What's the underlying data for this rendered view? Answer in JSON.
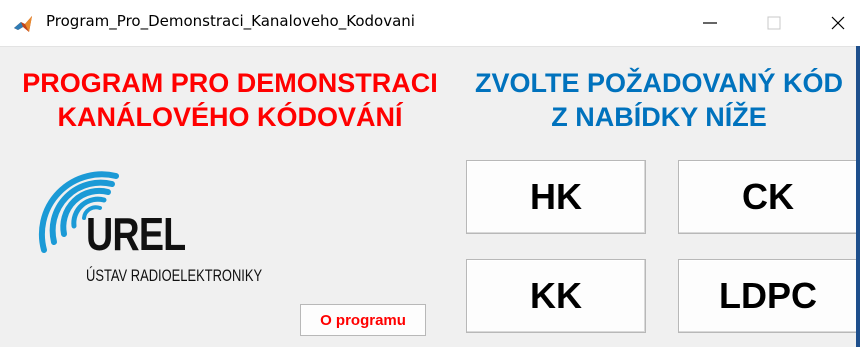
{
  "window": {
    "title": "Program_Pro_Demonstraci_Kanaloveho_Kodovani"
  },
  "header": {
    "left_line1": "PROGRAM PRO DEMONSTRACI",
    "left_line2": "KANÁLOVÉHO KÓDOVÁNÍ",
    "right_line1": "ZVOLTE POŽADOVANÝ KÓD",
    "right_line2": "Z NABÍDKY NÍŽE"
  },
  "buttons": {
    "hk": "HK",
    "ck": "CK",
    "kk": "KK",
    "ldpc": "LDPC",
    "about": "O programu"
  },
  "logo": {
    "name": "UREL",
    "subtitle": "ÚSTAV RADIOELEKTRONIKY"
  },
  "colors": {
    "heading_left": "#ff0000",
    "heading_right": "#0072bd",
    "logo_arcs": "#1b9ad6"
  }
}
